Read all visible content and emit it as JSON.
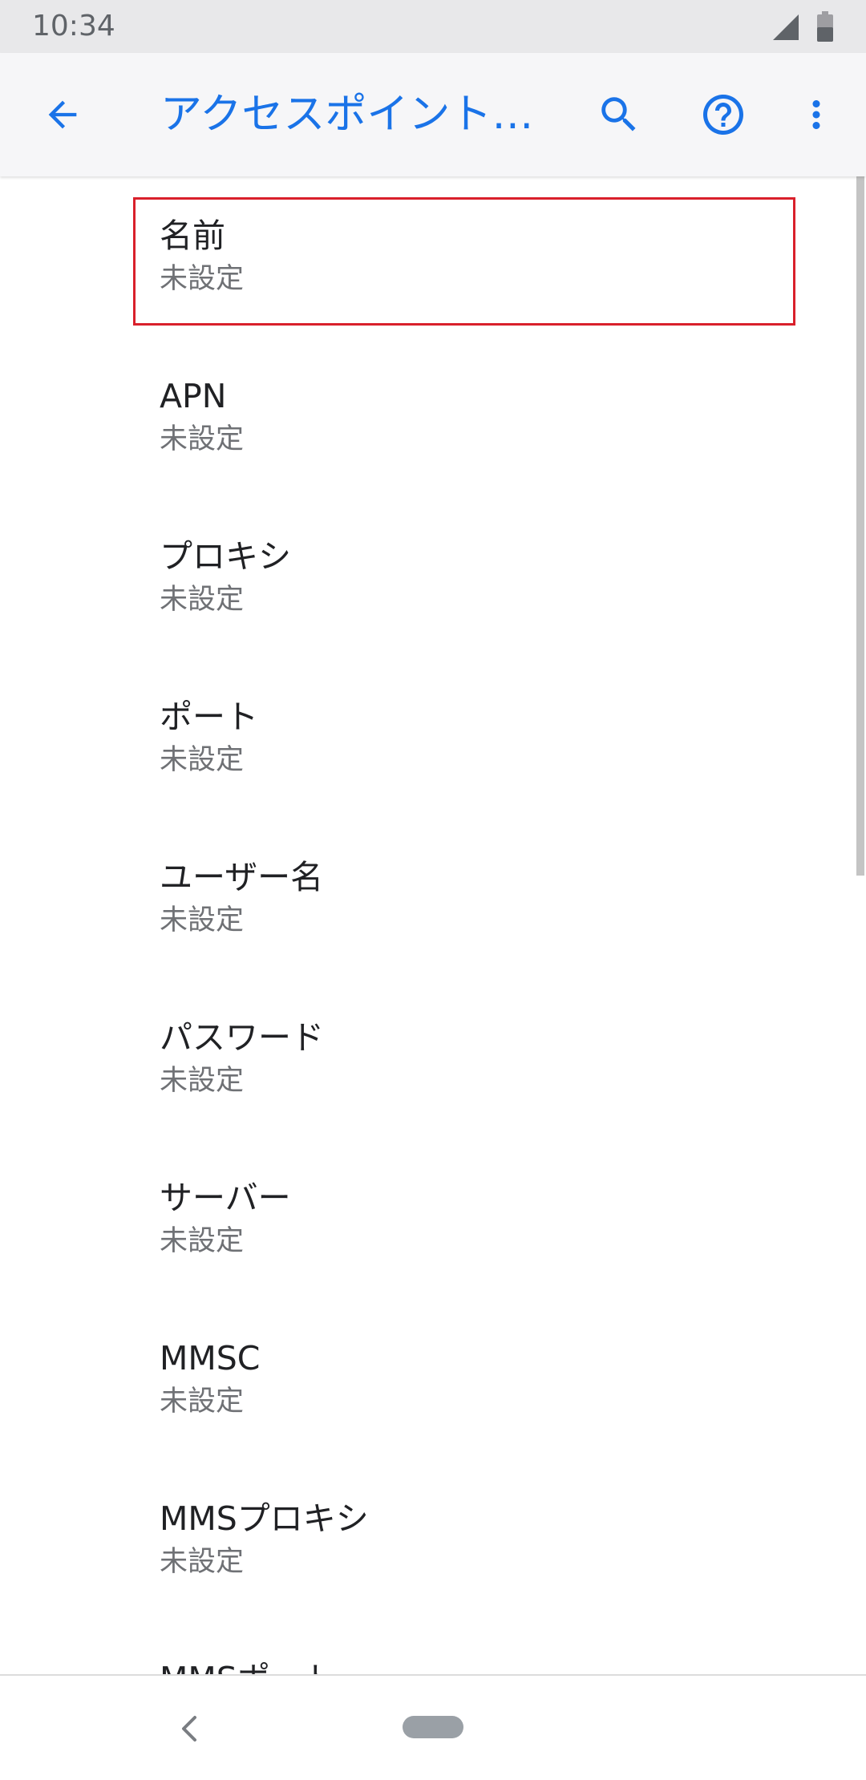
{
  "status_bar": {
    "time": "10:34",
    "icons": [
      "signal-icon",
      "battery-icon"
    ]
  },
  "app_bar": {
    "title": "アクセスポイント…",
    "accent_color": "#1a73e8",
    "actions": [
      "back-arrow-icon",
      "search-icon",
      "help-icon",
      "more-vert-icon"
    ]
  },
  "list": {
    "items": [
      {
        "title": "名前",
        "summary": "未設定",
        "highlighted": true
      },
      {
        "title": "APN",
        "summary": "未設定"
      },
      {
        "title": "プロキシ",
        "summary": "未設定"
      },
      {
        "title": "ポート",
        "summary": "未設定"
      },
      {
        "title": "ユーザー名",
        "summary": "未設定"
      },
      {
        "title": "パスワード",
        "summary": "未設定"
      },
      {
        "title": "サーバー",
        "summary": "未設定"
      },
      {
        "title": "MMSC",
        "summary": "未設定"
      },
      {
        "title": "MMSプロキシ",
        "summary": "未設定"
      },
      {
        "title": "MMSポート",
        "summary": ""
      }
    ],
    "highlight_color": "#d9202b"
  },
  "nav_bar": {
    "icons": [
      "nav-back-icon",
      "home-pill-icon"
    ]
  }
}
